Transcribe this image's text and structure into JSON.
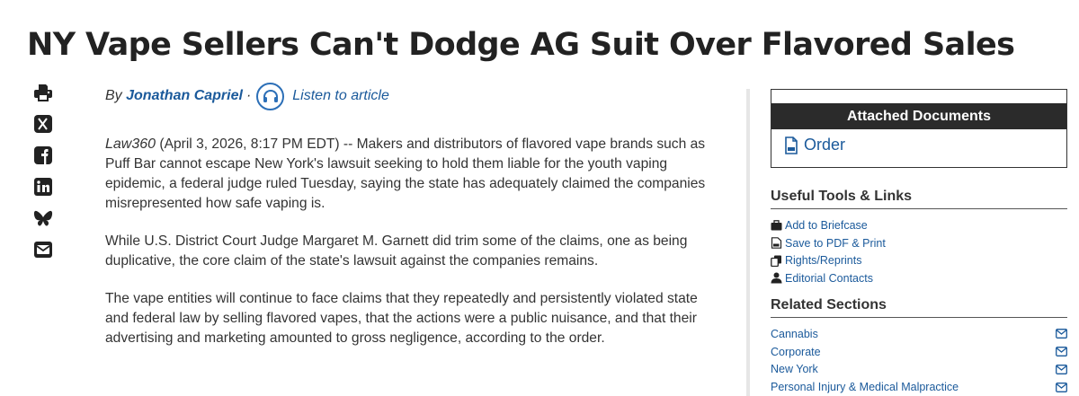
{
  "article": {
    "headline": "NY Vape Sellers Can't Dodge AG Suit Over Flavored Sales",
    "by_prefix": "By",
    "author": "Jonathan Capriel",
    "byline_separator": "·",
    "listen_label": "Listen to article",
    "source_name": "Law360",
    "dateline": " (April 3, 2026, 8:17 PM EDT) -- Makers and distributors of flavored vape brands such as Puff Bar cannot escape New York's lawsuit seeking to hold them liable for the youth vaping epidemic, a federal judge ruled Tuesday, saying the state has adequately claimed the companies misrepresented how safe vaping is.",
    "paragraphs": [
      "While U.S. District Court Judge Margaret M. Garnett did trim some of the claims, one as being duplicative, the core claim of the state's lawsuit against the companies remains.",
      "The vape entities will continue to face claims that they repeatedly and persistently violated state and federal law by selling flavored vapes, that the actions were a public nuisance, and that their advertising and marketing amounted to gross negligence, according to the order."
    ]
  },
  "share_icons": [
    "print-icon",
    "x-twitter-icon",
    "facebook-icon",
    "linkedin-icon",
    "bluesky-icon",
    "email-icon"
  ],
  "sidebar": {
    "attached_documents_title": "Attached Documents",
    "documents": [
      {
        "label": "Order",
        "icon": "pdf-icon"
      }
    ],
    "tools_title": "Useful Tools & Links",
    "tools": [
      {
        "label": "Add to Briefcase",
        "icon": "briefcase-icon"
      },
      {
        "label": "Save to PDF & Print",
        "icon": "pdf-icon"
      },
      {
        "label": "Rights/Reprints",
        "icon": "copy-icon"
      },
      {
        "label": "Editorial Contacts",
        "icon": "person-icon"
      }
    ],
    "related_title": "Related Sections",
    "related": [
      {
        "label": "Cannabis",
        "icon": "envelope-icon"
      },
      {
        "label": "Corporate",
        "icon": "envelope-icon"
      },
      {
        "label": "New York",
        "icon": "envelope-icon"
      },
      {
        "label": "Personal Injury & Medical Malpractice",
        "icon": "envelope-icon"
      }
    ]
  },
  "colors": {
    "link": "#1b5a9b",
    "header_bg": "#2b2b2b",
    "text": "#333333"
  }
}
